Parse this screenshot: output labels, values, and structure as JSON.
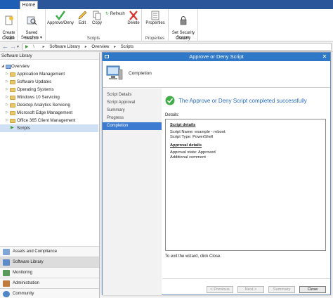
{
  "ribbon": {
    "tabs": {
      "file": "",
      "home": "Home"
    },
    "groups": {
      "create": {
        "label": "Create",
        "button": "Create\nScript"
      },
      "search": {
        "label": "Search",
        "button": "Saved\nSearches ▾"
      },
      "scripts": {
        "label": "Scripts",
        "approve": "Approve/Deny",
        "edit": "Edit",
        "copy": "Copy",
        "refresh": "Refresh",
        "delete": "Delete"
      },
      "properties": {
        "label": "Properties",
        "button": "Properties"
      },
      "classify": {
        "label": "Classify",
        "button": "Set Security\nScopes"
      }
    }
  },
  "address": {
    "root": "\\",
    "crumbs": [
      "Software Library",
      "Overview",
      "Scripts"
    ]
  },
  "left": {
    "header": "Software Library",
    "tree": [
      {
        "label": "Overview",
        "root": true
      },
      {
        "label": "Application Management"
      },
      {
        "label": "Software Updates"
      },
      {
        "label": "Operating Systems"
      },
      {
        "label": "Windows 10 Servicing"
      },
      {
        "label": "Desktop Analytics Servicing"
      },
      {
        "label": "Microsoft Edge Management"
      },
      {
        "label": "Office 365 Client Management"
      },
      {
        "label": "Scripts",
        "selected": true
      }
    ],
    "workspaces": [
      "Assets and Compliance",
      "Software Library",
      "Monitoring",
      "Administration",
      "Community"
    ]
  },
  "dialog": {
    "title": "Approve or Deny Script",
    "page_heading": "Completion",
    "nav": [
      "Script Details",
      "Script Approval",
      "Summary",
      "Progress",
      "Completion"
    ],
    "success_message": "The Approve or Deny Script completed successfully",
    "details_label": "Details:",
    "details": {
      "script_heading": "Script details",
      "script_name": "Script Name: example - reboot",
      "script_type": "Script Type: PowerShell",
      "approval_heading": "Approval details",
      "approval_state": "Approval state: Approved",
      "comment": "Additional comment"
    },
    "exit_text": "To exit the wizard, click Close.",
    "buttons": {
      "previous": "< Previous",
      "next": "Next >",
      "summary": "Summary",
      "close": "Close"
    }
  },
  "colors": {
    "accent": "#2f78c8",
    "success": "#3fae49",
    "title_bar": "#2f78c8"
  }
}
